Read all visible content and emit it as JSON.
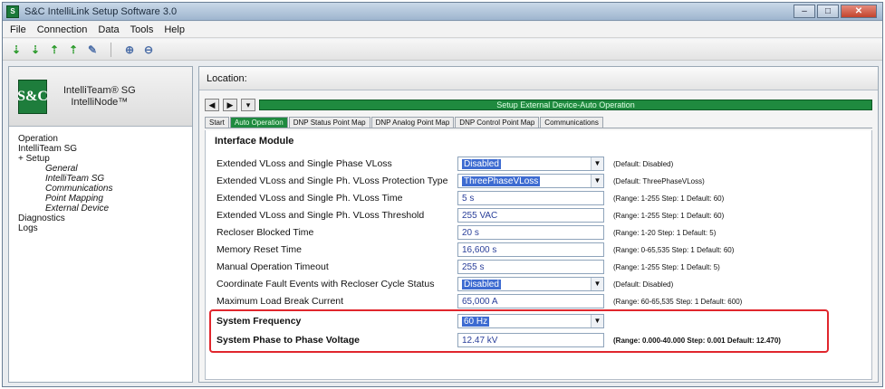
{
  "window": {
    "title": "S&C IntelliLink Setup Software 3.0",
    "controls": {
      "minimize": "–",
      "maximize": "□",
      "close": "✕"
    }
  },
  "menu": [
    "File",
    "Connection",
    "Data",
    "Tools",
    "Help"
  ],
  "toolbar": {
    "icons": [
      "down-arrow-green",
      "down-arrow-green",
      "up-arrow-green",
      "up-arrow-green",
      "pencil",
      "zoom-in",
      "zoom-out"
    ]
  },
  "brand": {
    "logo": "S&C",
    "line1": "IntelliTeam® SG",
    "line2": "IntelliNode™"
  },
  "tree": [
    {
      "label": "Operation",
      "level": 1
    },
    {
      "label": "IntelliTeam SG",
      "level": 1
    },
    {
      "label": "+ Setup",
      "level": 1
    },
    {
      "label": "General",
      "level": 3
    },
    {
      "label": "IntelliTeam SG",
      "level": 3
    },
    {
      "label": "Communications",
      "level": 3
    },
    {
      "label": "Point Mapping",
      "level": 3
    },
    {
      "label": "External Device",
      "level": 3
    },
    {
      "label": "Diagnostics",
      "level": 1
    },
    {
      "label": "Logs",
      "level": 1
    }
  ],
  "location_label": "Location:",
  "banner": "Setup External Device-Auto Operation",
  "tabs": [
    {
      "label": "Start",
      "active": false
    },
    {
      "label": "Auto Operation",
      "active": true
    },
    {
      "label": "DNP Status Point Map",
      "active": false
    },
    {
      "label": "DNP Analog Point Map",
      "active": false
    },
    {
      "label": "DNP Control Point Map",
      "active": false
    },
    {
      "label": "Communications",
      "active": false
    }
  ],
  "section_title": "Interface Module",
  "rows": [
    {
      "label": "Extended VLoss and Single Phase VLoss",
      "type": "dropdown",
      "value": "Disabled",
      "note": "(Default: Disabled)"
    },
    {
      "label": "Extended VLoss and Single Ph. VLoss Protection Type",
      "type": "dropdown",
      "value": "ThreePhaseVLoss",
      "note": "(Default: ThreePhaseVLoss)"
    },
    {
      "label": "Extended VLoss and Single Ph. VLoss Time",
      "type": "text",
      "value": "5 s",
      "note": "(Range: 1-255 Step: 1 Default: 60)"
    },
    {
      "label": "Extended VLoss and Single Ph. VLoss Threshold",
      "type": "text",
      "value": "255 VAC",
      "note": "(Range: 1-255 Step: 1 Default: 60)"
    },
    {
      "label": "Recloser Blocked Time",
      "type": "text",
      "value": "20 s",
      "note": "(Range: 1-20 Step: 1 Default: 5)"
    },
    {
      "label": "Memory Reset Time",
      "type": "text",
      "value": "16,600 s",
      "note": "(Range: 0-65,535 Step: 1 Default: 60)"
    },
    {
      "label": "Manual Operation Timeout",
      "type": "text",
      "value": "255 s",
      "note": "(Range: 1-255 Step: 1 Default: 5)"
    },
    {
      "label": "Coordinate Fault Events with Recloser Cycle Status",
      "type": "dropdown",
      "value": "Disabled",
      "note": "(Default: Disabled)"
    },
    {
      "label": "Maximum Load Break Current",
      "type": "text",
      "value": "65,000 A",
      "note": "(Range: 60-65,535 Step: 1 Default: 600)"
    },
    {
      "label": "System Frequency",
      "type": "dropdown",
      "value": "60 Hz",
      "note": "",
      "bold": true,
      "highlighted": true
    },
    {
      "label": "System Phase to Phase Voltage",
      "type": "text",
      "value": "12.47 kV",
      "note": "(Range: 0.000-40.000 Step: 0.001 Default: 12.470)",
      "bold": true
    }
  ]
}
